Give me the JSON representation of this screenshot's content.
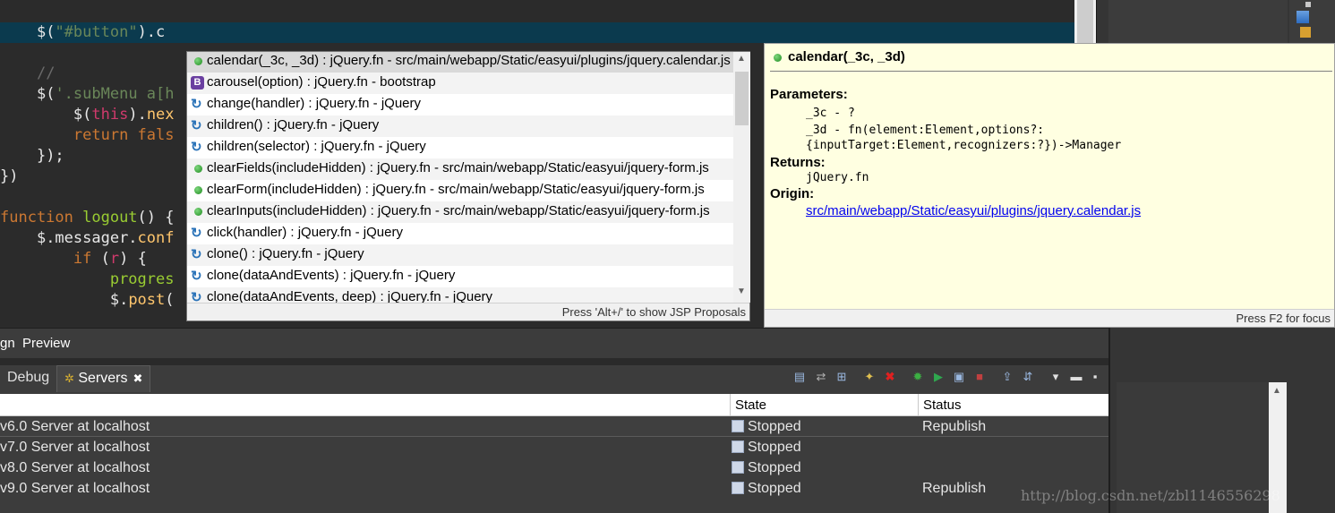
{
  "editor": {
    "lines": [
      {
        "indent": "    ",
        "parts": [
          {
            "t": "$(",
            "c": ""
          },
          {
            "t": "\"#button\"",
            "c": "tok-str"
          },
          {
            "t": ").c",
            "c": ""
          }
        ]
      },
      {
        "indent": "    ",
        "parts": [
          {
            "t": "//",
            "c": "tok-cmt"
          }
        ]
      },
      {
        "indent": "    ",
        "parts": [
          {
            "t": "$(",
            "c": ""
          },
          {
            "t": "'.subMenu a[h",
            "c": "tok-str"
          }
        ]
      },
      {
        "indent": "        ",
        "parts": [
          {
            "t": "$(",
            "c": ""
          },
          {
            "t": "this",
            "c": "tok-this"
          },
          {
            "t": ").",
            "c": ""
          },
          {
            "t": "nex",
            "c": "tok-prop"
          }
        ]
      },
      {
        "indent": "        ",
        "parts": [
          {
            "t": "return fals",
            "c": "tok-kw"
          }
        ]
      },
      {
        "indent": "    ",
        "parts": [
          {
            "t": "});",
            "c": ""
          }
        ]
      },
      {
        "indent": "",
        "parts": [
          {
            "t": "})",
            "c": ""
          }
        ]
      },
      {
        "indent": "",
        "parts": [
          {
            "t": "function ",
            "c": "tok-kw"
          },
          {
            "t": "logout",
            "c": "tok-fn"
          },
          {
            "t": "() {",
            "c": ""
          }
        ]
      },
      {
        "indent": "    ",
        "parts": [
          {
            "t": "$.messager.",
            "c": ""
          },
          {
            "t": "conf",
            "c": "tok-prop"
          }
        ]
      },
      {
        "indent": "        ",
        "parts": [
          {
            "t": "if",
            "c": "tok-kw"
          },
          {
            "t": " (",
            "c": ""
          },
          {
            "t": "r",
            "c": "tok-this"
          },
          {
            "t": ") {",
            "c": ""
          }
        ]
      },
      {
        "indent": "            ",
        "parts": [
          {
            "t": "progres",
            "c": "tok-fn"
          }
        ]
      },
      {
        "indent": "            ",
        "parts": [
          {
            "t": "$.",
            "c": ""
          },
          {
            "t": "post",
            "c": "tok-prop"
          },
          {
            "t": "(",
            "c": ""
          }
        ]
      }
    ]
  },
  "content_assist": {
    "proposals": [
      {
        "icon": "dot",
        "label": "calendar(_3c, _3d) : jQuery.fn - src/main/webapp/Static/easyui/plugins/jquery.calendar.js",
        "selected": true
      },
      {
        "icon": "bootstrap",
        "label": "carousel(option) : jQuery.fn - bootstrap"
      },
      {
        "icon": "jquery",
        "label": "change(handler) : jQuery.fn - jQuery"
      },
      {
        "icon": "jquery",
        "label": "children() : jQuery.fn - jQuery"
      },
      {
        "icon": "jquery",
        "label": "children(selector) : jQuery.fn - jQuery"
      },
      {
        "icon": "dot",
        "label": "clearFields(includeHidden) : jQuery.fn - src/main/webapp/Static/easyui/jquery-form.js"
      },
      {
        "icon": "dot",
        "label": "clearForm(includeHidden) : jQuery.fn - src/main/webapp/Static/easyui/jquery-form.js"
      },
      {
        "icon": "dot",
        "label": "clearInputs(includeHidden) : jQuery.fn - src/main/webapp/Static/easyui/jquery-form.js"
      },
      {
        "icon": "jquery",
        "label": "click(handler) : jQuery.fn - jQuery"
      },
      {
        "icon": "jquery",
        "label": "clone() : jQuery.fn - jQuery"
      },
      {
        "icon": "jquery",
        "label": "clone(dataAndEvents) : jQuery.fn - jQuery"
      },
      {
        "icon": "jquery",
        "label": "clone(dataAndEvents, deep) : jQuery.fn - jQuery"
      }
    ],
    "footer": "Press 'Alt+/' to show JSP Proposals"
  },
  "doc": {
    "title": "calendar(_3c, _3d)",
    "parameters_label": "Parameters:",
    "param1": "_3c - ?",
    "param2": "_3d - fn(element:Element,options?:",
    "param2_cont": "{inputTarget:Element,recognizers:?})->Manager",
    "returns_label": "Returns:",
    "returns_value": "jQuery.fn",
    "origin_label": "Origin:",
    "origin_link": "src/main/webapp/Static/easyui/plugins/jquery.calendar.js",
    "footer": "Press F2 for focus"
  },
  "editor_tabs": {
    "design": "gn",
    "preview": "Preview"
  },
  "servers_view": {
    "tabs": [
      {
        "label": "Debug"
      },
      {
        "label": "Servers"
      }
    ],
    "columns": {
      "name": "",
      "state": "State",
      "status": "Status"
    },
    "rows": [
      {
        "name": "v6.0 Server at localhost",
        "state": "Stopped",
        "status": "Republish"
      },
      {
        "name": "v7.0 Server at localhost",
        "state": "Stopped",
        "status": ""
      },
      {
        "name": "v8.0 Server at localhost",
        "state": "Stopped",
        "status": ""
      },
      {
        "name": "v9.0 Server at localhost",
        "state": "Stopped",
        "status": "Republish"
      }
    ]
  },
  "watermark": "http://blog.csdn.net/zbl1146556298",
  "colors": {
    "editor_bg": "#2b2b2b",
    "current_line": "#0b3a4e",
    "doc_bg": "#ffffe1",
    "link": "#0000ee"
  }
}
